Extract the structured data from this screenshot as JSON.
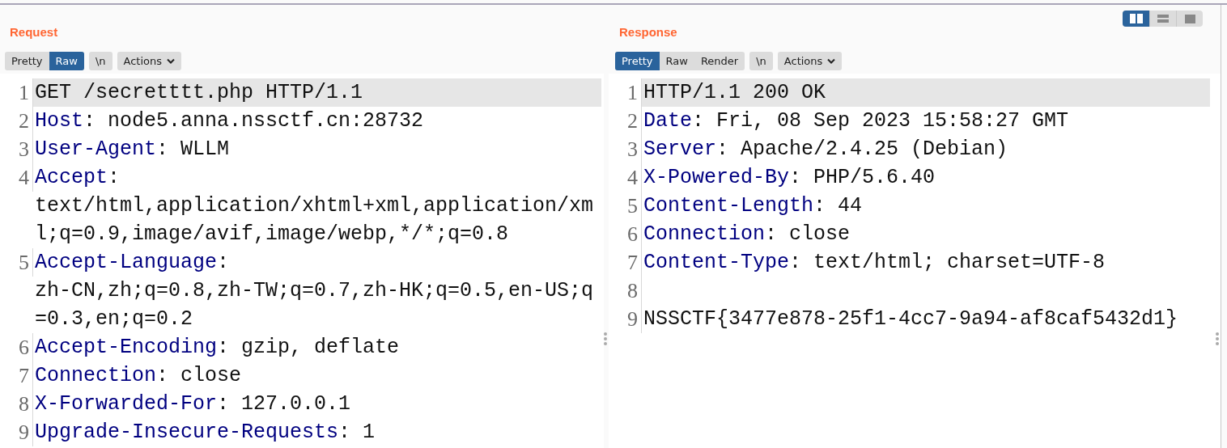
{
  "layout_toggle": [
    {
      "kind": "columns",
      "selected": true
    },
    {
      "kind": "rows",
      "selected": false
    },
    {
      "kind": "single",
      "selected": false
    }
  ],
  "panels": [
    {
      "title": "Request",
      "views": [
        {
          "label": "Pretty",
          "selected": false
        },
        {
          "label": "Raw",
          "selected": true
        }
      ],
      "newline_button": "\\n",
      "actions_button": "Actions",
      "lines": [
        {
          "number": "1",
          "kind": "text",
          "text": "GET /secretttt.php HTTP/1.1",
          "current": true
        },
        {
          "number": "2",
          "kind": "header",
          "name": "Host",
          "value": ": node5.anna.nssctf.cn:28732",
          "current": false
        },
        {
          "number": "3",
          "kind": "header",
          "name": "User-Agent",
          "value": ": WLLM",
          "current": false
        },
        {
          "number": "4",
          "kind": "header",
          "name": "Accept",
          "value": ": text/html,application/xhtml+xml,application/xml;q=0.9,image/avif,image/webp,*/*;q=0.8",
          "current": false
        },
        {
          "number": "5",
          "kind": "header",
          "name": "Accept-Language",
          "value": ": zh-CN,zh;q=0.8,zh-TW;q=0.7,zh-HK;q=0.5,en-US;q=0.3,en;q=0.2",
          "current": false
        },
        {
          "number": "6",
          "kind": "header",
          "name": "Accept-Encoding",
          "value": ": gzip, deflate",
          "current": false
        },
        {
          "number": "7",
          "kind": "header",
          "name": "Connection",
          "value": ": close",
          "current": false
        },
        {
          "number": "8",
          "kind": "header",
          "name": "X-Forwarded-For",
          "value": ": 127.0.0.1",
          "current": false
        },
        {
          "number": "9",
          "kind": "header",
          "name": "Upgrade-Insecure-Requests",
          "value": ": 1",
          "current": false
        }
      ]
    },
    {
      "title": "Response",
      "views": [
        {
          "label": "Pretty",
          "selected": true
        },
        {
          "label": "Raw",
          "selected": false
        },
        {
          "label": "Render",
          "selected": false
        }
      ],
      "newline_button": "\\n",
      "actions_button": "Actions",
      "lines": [
        {
          "number": "1",
          "kind": "text",
          "text": "HTTP/1.1 200 OK",
          "current": true
        },
        {
          "number": "2",
          "kind": "header",
          "name": "Date",
          "value": ": Fri, 08 Sep 2023 15:58:27 GMT",
          "current": false
        },
        {
          "number": "3",
          "kind": "header",
          "name": "Server",
          "value": ": Apache/2.4.25 (Debian)",
          "current": false
        },
        {
          "number": "4",
          "kind": "header",
          "name": "X-Powered-By",
          "value": ": PHP/5.6.40",
          "current": false
        },
        {
          "number": "5",
          "kind": "header",
          "name": "Content-Length",
          "value": ": 44",
          "current": false
        },
        {
          "number": "6",
          "kind": "header",
          "name": "Connection",
          "value": ": close",
          "current": false
        },
        {
          "number": "7",
          "kind": "header",
          "name": "Content-Type",
          "value": ": text/html; charset=UTF-8",
          "current": false
        },
        {
          "number": "8",
          "kind": "blank",
          "current": false
        },
        {
          "number": "9",
          "kind": "text",
          "text": "NSSCTF{3477e878-25f1-4cc7-9a94-af8caf5432d1}",
          "current": false
        }
      ]
    }
  ]
}
